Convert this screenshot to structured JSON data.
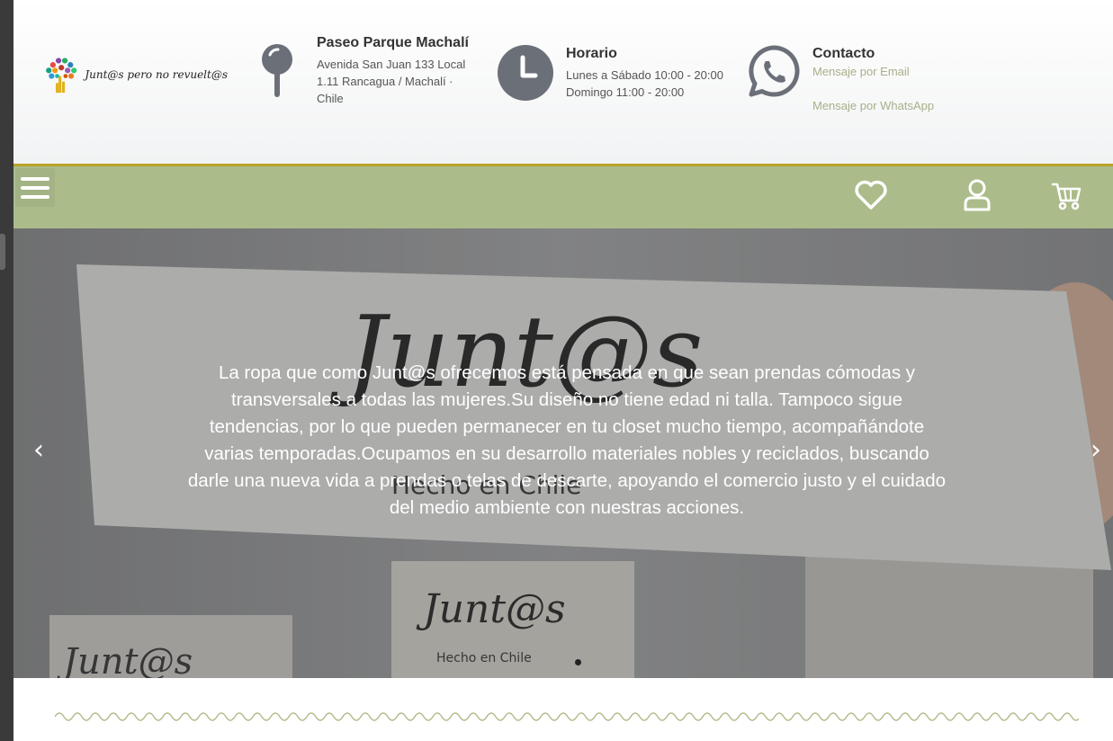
{
  "logo": {
    "text": "Junt@s pero no revuelt@s"
  },
  "location": {
    "icon": "map-pin-icon",
    "title": "Paseo Parque Machalí",
    "address": "Avenida San Juan 133 Local 1.11 Rancagua / Machalí · Chile"
  },
  "hours": {
    "icon": "clock-icon",
    "title": "Horario",
    "text": "Lunes a Sábado 10:00 - 20:00 Domingo 11:00 - 20:00"
  },
  "contact": {
    "icon": "whatsapp-icon",
    "title": "Contacto",
    "email_link": "Mensaje por Email",
    "whatsapp_link": "Mensaje por WhatsApp"
  },
  "navbar": {
    "menu_icon": "hamburger-menu-icon",
    "icons": [
      "heart-icon",
      "user-icon",
      "cart-icon"
    ]
  },
  "hero": {
    "text": "La ropa que como Junt@s ofrecemos está pensada en que sean prendas cómodas y transversales a todas las mujeres.Su diseño no tiene edad ni talla. Tampoco sigue tendencias, por lo que pueden permanecer en tu closet mucho tiempo, acompañándote varias temporadas.Ocupamos en su desarrollo materiales nobles y reciclados, buscando darle una nueva vida a prendas o telas de descarte, apoyando el comercio justo y el cuidado del medio ambiente con nuestras acciones.",
    "prev_arrow": "‹",
    "next_arrow": "›",
    "label_text_main": "Junt@s",
    "label_text_small": "Junt@s",
    "label_made": "Hecho en Chile"
  },
  "colors": {
    "navbar": "#abbc8a",
    "accent_line": "#b9a22a",
    "link": "#a8b089",
    "icon_gray": "#6b6f78"
  }
}
